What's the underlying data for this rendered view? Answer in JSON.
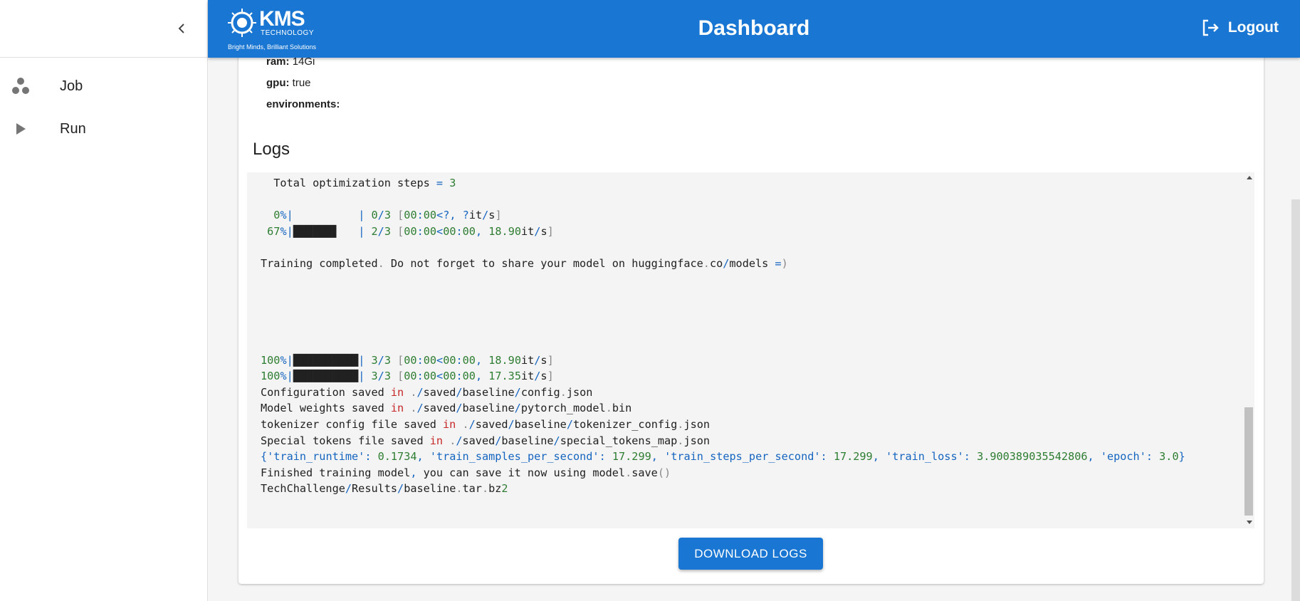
{
  "sidebar": {
    "items": [
      {
        "label": "Job",
        "icon": "job-icon"
      },
      {
        "label": "Run",
        "icon": "play-icon"
      }
    ]
  },
  "header": {
    "title": "Dashboard",
    "logout_label": "Logout",
    "logo": {
      "brand": "KMS",
      "sub": "TECHNOLOGY",
      "tagline": "Bright Minds, Brilliant Solutions"
    }
  },
  "job_props": {
    "ram_label": "ram:",
    "ram_value": "14Gi",
    "gpu_label": "gpu:",
    "gpu_value": "true",
    "env_label": "environments:"
  },
  "logs": {
    "title": "Logs",
    "lines": [
      "  Total optimization steps = 3",
      "",
      "  0%|          | 0/3 [00:00<?, ?it/s]",
      " 67%|██████▋   | 2/3 [00:00<00:00, 18.90it/s]",
      "",
      "Training completed. Do not forget to share your model on huggingface.co/models =)",
      "",
      "",
      "",
      "",
      "",
      "100%|██████████| 3/3 [00:00<00:00, 18.90it/s]",
      "100%|██████████| 3/3 [00:00<00:00, 17.35it/s]",
      "Configuration saved in ./saved/baseline/config.json",
      "Model weights saved in ./saved/baseline/pytorch_model.bin",
      "tokenizer config file saved in ./saved/baseline/tokenizer_config.json",
      "Special tokens file saved in ./saved/baseline/special_tokens_map.json",
      "{'train_runtime': 0.1734, 'train_samples_per_second': 17.299, 'train_steps_per_second': 17.299, 'train_loss': 3.900389035542806, 'epoch': 3.0}",
      "Finished training model, you can save it now using model.save()",
      "TechChallenge/Results/baseline.tar.bz2"
    ],
    "download_label": "DOWNLOAD LOGS"
  },
  "colors": {
    "primary": "#1976d2",
    "number": "#2e7d32",
    "keyword": "#c62828",
    "operator": "#1565c0"
  }
}
